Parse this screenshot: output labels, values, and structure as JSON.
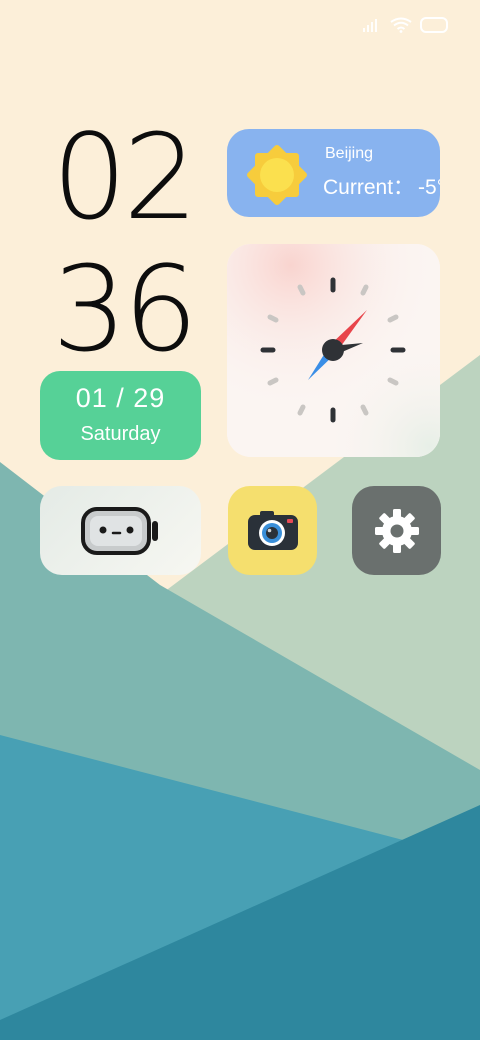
{
  "status_bar": {
    "icons": [
      "signal-icon",
      "wifi-icon",
      "battery-icon"
    ]
  },
  "clock": {
    "hour": "02",
    "minute": "36"
  },
  "date_widget": {
    "date": "01 / 29",
    "weekday": "Saturday",
    "color": "#56d197"
  },
  "weather_widget": {
    "city": "Beijing",
    "current_label": "Current：",
    "temperature": "-5°",
    "icon": "sun-icon",
    "color": "#88b3ef"
  },
  "analog_clock": {
    "icon": "compass-clock-icon",
    "needle_colors": [
      "#e8454b",
      "#3a8ee6"
    ]
  },
  "apps": [
    {
      "name": "robot-app",
      "icon": "robot-face-icon"
    },
    {
      "name": "camera-app",
      "icon": "camera-icon",
      "color": "#f5df6e"
    },
    {
      "name": "settings-app",
      "icon": "gear-icon",
      "color": "#6a706e"
    }
  ],
  "wallpaper": {
    "colors": [
      "#fcefd9",
      "#bcd3bf",
      "#7eb6b0",
      "#48a0b4",
      "#2e879e"
    ]
  }
}
